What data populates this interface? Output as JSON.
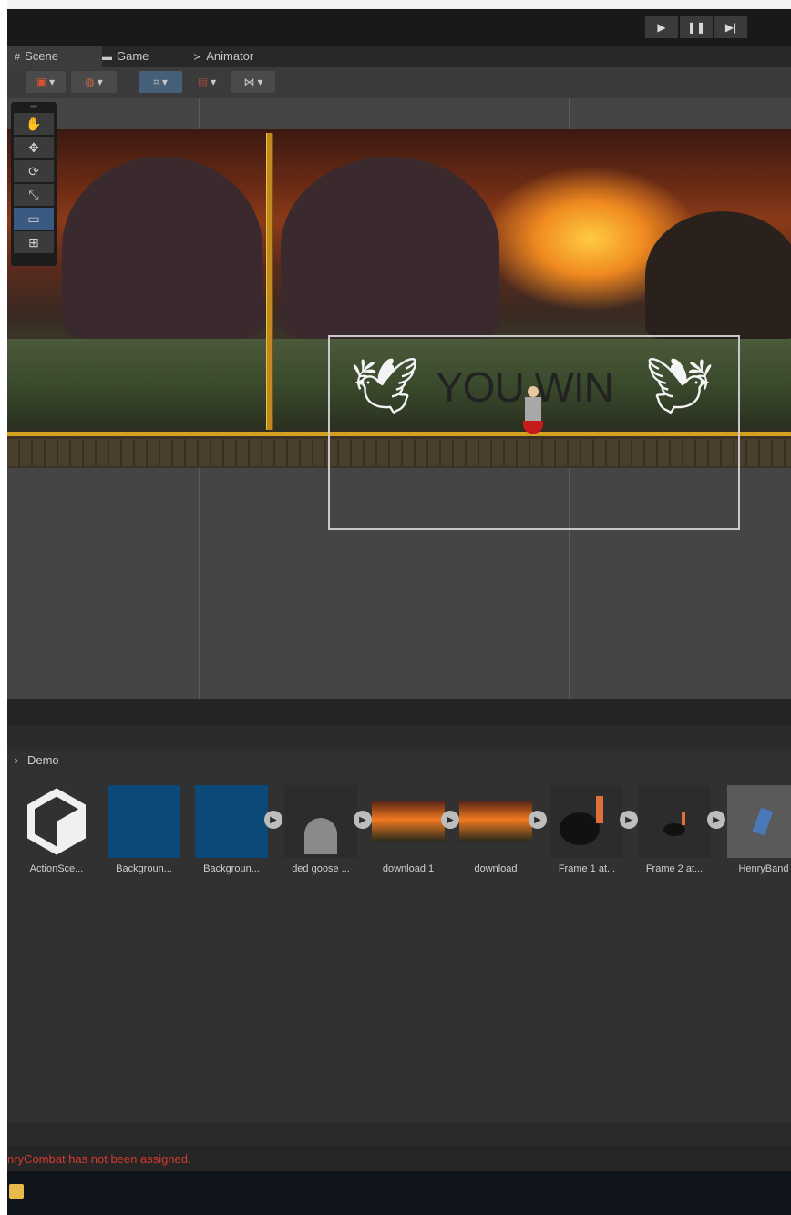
{
  "toolbar": {
    "play_icon": "play-icon",
    "pause_icon": "pause-icon",
    "step_icon": "step-icon"
  },
  "tabs": [
    {
      "label": "Scene",
      "icon": "scene-icon",
      "active": true
    },
    {
      "label": "Game",
      "icon": "gamepad-icon",
      "active": false
    },
    {
      "label": "Animator",
      "icon": "animator-icon",
      "active": false
    }
  ],
  "scene": {
    "overlay_text": "YOU WIN",
    "tools": [
      "hand-tool-icon",
      "move-tool-icon",
      "rotate-tool-icon",
      "scale-tool-icon",
      "rect-tool-icon",
      "transform-tool-icon"
    ],
    "active_tool": "rect-tool-icon"
  },
  "project": {
    "breadcrumb": "Demo",
    "assets": [
      {
        "label": "ActionSce...",
        "type": "unity-logo"
      },
      {
        "label": "Backgroun...",
        "type": "blue"
      },
      {
        "label": "Backgroun...",
        "type": "blue"
      },
      {
        "label": "ded goose ...",
        "type": "tombstone"
      },
      {
        "label": "download 1",
        "type": "sunset"
      },
      {
        "label": "download",
        "type": "sunset"
      },
      {
        "label": "Frame 1 at...",
        "type": "goose"
      },
      {
        "label": "Frame 2 at...",
        "type": "goose-small"
      },
      {
        "label": "HenryBand",
        "type": "character"
      }
    ]
  },
  "console": {
    "message": "nryCombat has not been assigned."
  },
  "colors": {
    "accent": "#3a5a82",
    "error": "#d73a2e",
    "asset_blue": "#0b4a78"
  }
}
